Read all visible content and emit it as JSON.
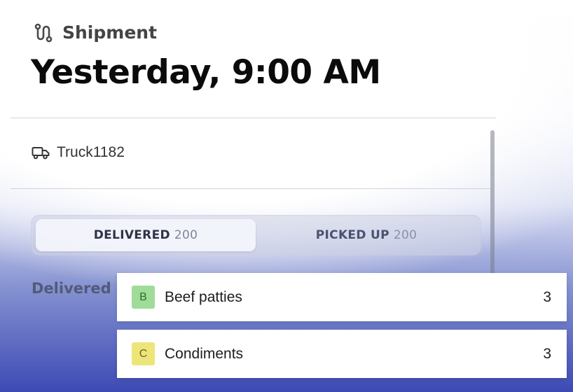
{
  "header": {
    "label": "Shipment",
    "icon": "route-icon",
    "title": "Yesterday, 9:00 AM"
  },
  "vehicle": {
    "icon": "truck-icon",
    "name": "Truck1182"
  },
  "tabs": [
    {
      "label": "DELIVERED",
      "count": "200",
      "active": true
    },
    {
      "label": "PICKED UP",
      "count": "200",
      "active": false
    }
  ],
  "section": {
    "heading": "Delivered"
  },
  "items": [
    {
      "badge": "B",
      "badge_color": "#9fdc9a",
      "name": "Beef patties",
      "qty": "3"
    },
    {
      "badge": "C",
      "badge_color": "#eee57a",
      "name": "Condiments",
      "qty": "3"
    }
  ]
}
